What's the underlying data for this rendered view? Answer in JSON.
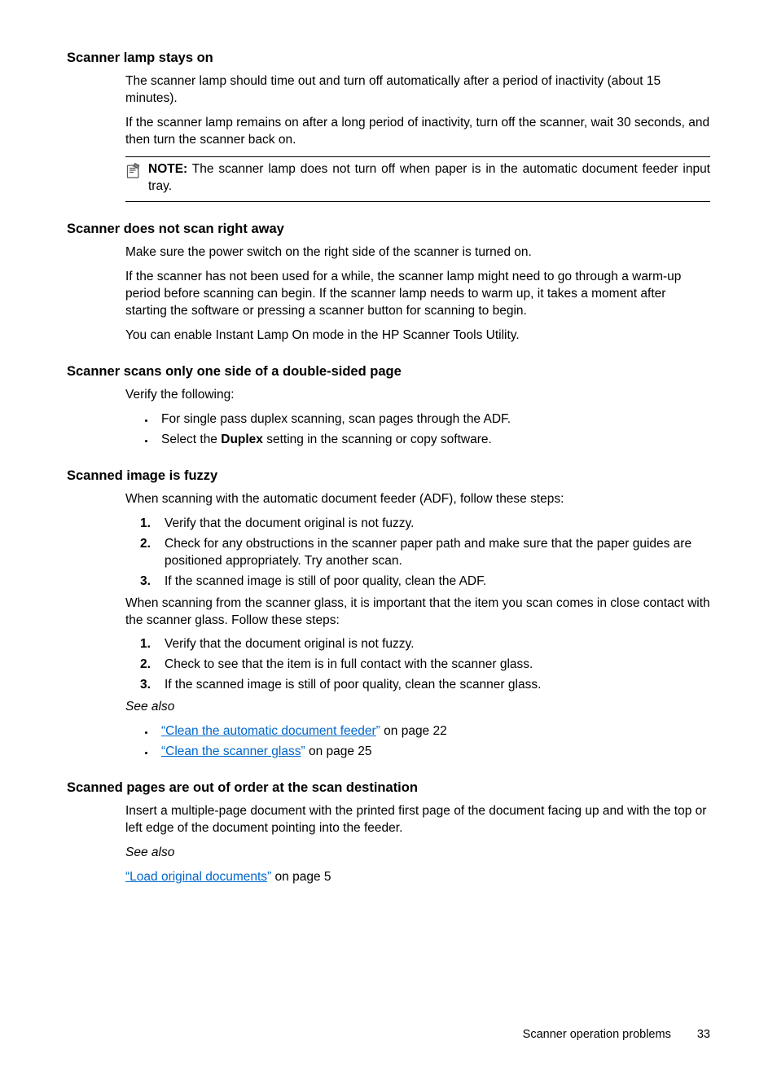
{
  "sections": {
    "lamp": {
      "heading": "Scanner lamp stays on",
      "p1": "The scanner lamp should time out and turn off automatically after a period of inactivity (about 15 minutes).",
      "p2": "If the scanner lamp remains on after a long period of inactivity, turn off the scanner, wait 30 seconds, and then turn the scanner back on.",
      "note_label": "NOTE:",
      "note_text": "The scanner lamp does not turn off when paper is in the automatic document feeder input tray."
    },
    "rightaway": {
      "heading": "Scanner does not scan right away",
      "p1": "Make sure the power switch on the right side of the scanner is turned on.",
      "p2": "If the scanner has not been used for a while, the scanner lamp might need to go through a warm-up period before scanning can begin. If the scanner lamp needs to warm up, it takes a moment after starting the software or pressing a scanner button for scanning to begin.",
      "p3": "You can enable Instant Lamp On mode in the HP Scanner Tools Utility."
    },
    "oneside": {
      "heading": "Scanner scans only one side of a double-sided page",
      "p1": "Verify the following:",
      "b1": "For single pass duplex scanning, scan pages through the ADF.",
      "b2_pre": "Select the ",
      "b2_bold": "Duplex",
      "b2_post": " setting in the scanning or copy software."
    },
    "fuzzy": {
      "heading": "Scanned image is fuzzy",
      "p1": "When scanning with the automatic document feeder (ADF), follow these steps:",
      "n1": "1.",
      "n1t": "Verify that the document original is not fuzzy.",
      "n2": "2.",
      "n2t": "Check for any obstructions in the scanner paper path and make sure that the paper guides are positioned appropriately. Try another scan.",
      "n3": "3.",
      "n3t": "If the scanned image is still of poor quality, clean the ADF.",
      "p2": "When scanning from the scanner glass, it is important that the item you scan comes in close contact with the scanner glass. Follow these steps:",
      "m1": "1.",
      "m1t": "Verify that the document original is not fuzzy.",
      "m2": "2.",
      "m2t": "Check to see that the item is in full contact with the scanner glass.",
      "m3": "3.",
      "m3t": "If the scanned image is still of poor quality, clean the scanner glass.",
      "see_also": "See also",
      "link1_q1": "“",
      "link1_text": "Clean the automatic document feeder",
      "link1_q2": "”",
      "link1_tail": " on page 22",
      "link2_q1": "“",
      "link2_text": "Clean the scanner glass",
      "link2_q2": "”",
      "link2_tail": " on page 25"
    },
    "order": {
      "heading": "Scanned pages are out of order at the scan destination",
      "p1": "Insert a multiple-page document with the printed first page of the document facing up and with the top or left edge of the document pointing into the feeder.",
      "see_also": "See also",
      "link_q1": "“",
      "link_text": "Load original documents",
      "link_q2": "”",
      "link_tail": " on page 5"
    }
  },
  "footer": {
    "label": "Scanner operation problems",
    "page": "33"
  }
}
